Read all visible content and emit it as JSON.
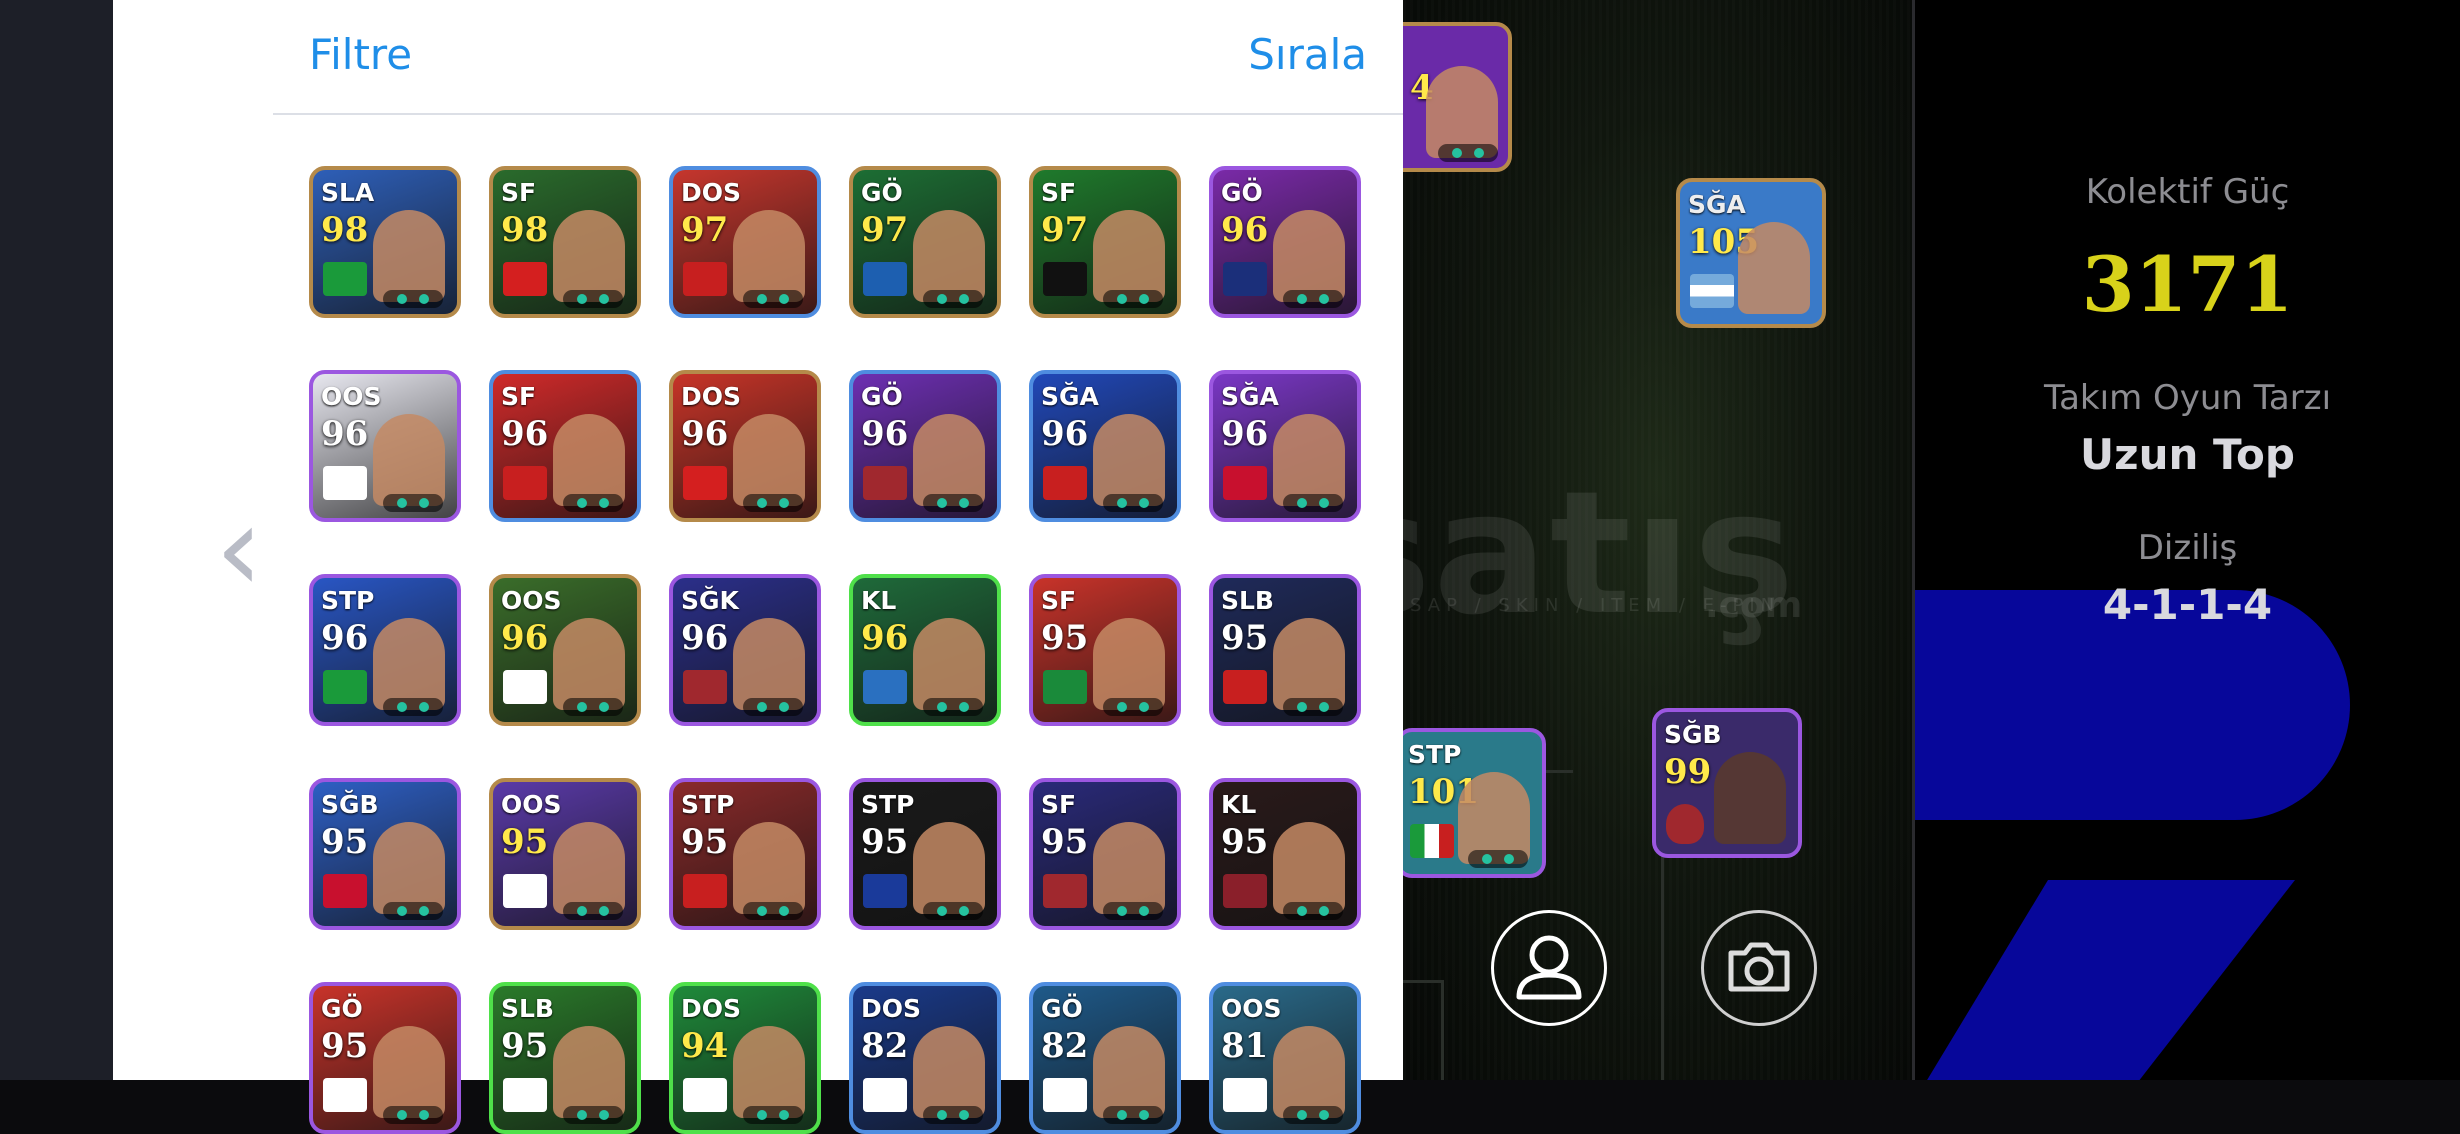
{
  "panel": {
    "filter_label": "Filtre",
    "sort_label": "Sırala"
  },
  "cards": [
    {
      "pos": "SLA",
      "rating": "98",
      "frame": "gold",
      "bg": "#2e5fb8",
      "badge": "#1a9a3a"
    },
    {
      "pos": "SF",
      "rating": "98",
      "frame": "gold",
      "bg": "#2a6b2c",
      "badge": "#d41f1f"
    },
    {
      "pos": "DOS",
      "rating": "97",
      "frame": "blue",
      "bg": "#c6362d",
      "badge": "#c71f1f"
    },
    {
      "pos": "GÖ",
      "rating": "97",
      "frame": "gold",
      "bg": "#1d6e34",
      "badge": "#1d5fb0"
    },
    {
      "pos": "SF",
      "rating": "97",
      "frame": "gold",
      "bg": "#1f7a2c",
      "badge": "#111111"
    },
    {
      "pos": "GÖ",
      "rating": "96",
      "frame": "purple",
      "bg": "#7a2aa8",
      "badge": "#1b2f7a"
    },
    {
      "pos": "OOS",
      "rating": "96",
      "frame": "purple",
      "bg": "#e7e7ef",
      "badge": "#ffffff",
      "white": true
    },
    {
      "pos": "SF",
      "rating": "96",
      "frame": "blue",
      "bg": "#d02a2a",
      "badge": "#c81f1f",
      "white": true
    },
    {
      "pos": "DOS",
      "rating": "96",
      "frame": "gold",
      "bg": "#c73428",
      "badge": "#d41f1f",
      "white": true
    },
    {
      "pos": "GÖ",
      "rating": "96",
      "frame": "blue",
      "bg": "#6d2fb2",
      "badge": "#a0282e",
      "white": true
    },
    {
      "pos": "SĞA",
      "rating": "96",
      "frame": "blue",
      "bg": "#2148b8",
      "badge": "#c81f1f",
      "white": true
    },
    {
      "pos": "SĞA",
      "rating": "96",
      "frame": "purple",
      "bg": "#7a37c5",
      "badge": "#c8102e",
      "white": true
    },
    {
      "pos": "STP",
      "rating": "96",
      "frame": "purple",
      "bg": "#2956c4",
      "badge": "#1a9a3a",
      "white": true
    },
    {
      "pos": "OOS",
      "rating": "96",
      "frame": "gold",
      "bg": "#3a6d2a",
      "badge": "#ffffff"
    },
    {
      "pos": "SĞK",
      "rating": "96",
      "frame": "purple",
      "bg": "#2b2f8a",
      "badge": "#a0282e",
      "white": true
    },
    {
      "pos": "KL",
      "rating": "96",
      "frame": "green",
      "bg": "#1f6a3a",
      "badge": "#2a70c0"
    },
    {
      "pos": "SF",
      "rating": "95",
      "frame": "purple",
      "bg": "#c8332a",
      "badge": "#1a8a3a",
      "white": true
    },
    {
      "pos": "SLB",
      "rating": "95",
      "frame": "purple",
      "bg": "#1f2a5a",
      "badge": "#c81f1f",
      "white": true
    },
    {
      "pos": "SĞB",
      "rating": "95",
      "frame": "purple",
      "bg": "#2e5fc4",
      "badge": "#c8102e",
      "white": true
    },
    {
      "pos": "OOS",
      "rating": "95",
      "frame": "gold",
      "bg": "#5a3aa8",
      "badge": "#ffffff"
    },
    {
      "pos": "STP",
      "rating": "95",
      "frame": "purple",
      "bg": "#8a2a2a",
      "badge": "#c81f1f",
      "white": true
    },
    {
      "pos": "STP",
      "rating": "95",
      "frame": "purple",
      "bg": "#1a1a1a",
      "badge": "#1a3a9a",
      "white": true
    },
    {
      "pos": "SF",
      "rating": "95",
      "frame": "purple",
      "bg": "#2a2a7a",
      "badge": "#a0282e",
      "white": true
    },
    {
      "pos": "KL",
      "rating": "95",
      "frame": "purple",
      "bg": "#2a1a1a",
      "badge": "#8a1f2a",
      "white": true
    },
    {
      "pos": "GÖ",
      "rating": "95",
      "frame": "purple",
      "bg": "#c8332a",
      "badge": "#ffffff",
      "white": true
    },
    {
      "pos": "SLB",
      "rating": "95",
      "frame": "green",
      "bg": "#2a7a2a",
      "badge": "#ffffff",
      "white": true
    },
    {
      "pos": "DOS",
      "rating": "94",
      "frame": "green",
      "bg": "#1f8a3a",
      "badge": "#ffffff"
    },
    {
      "pos": "DOS",
      "rating": "82",
      "frame": "blue",
      "bg": "#1a3a8a",
      "badge": "#ffffff",
      "white": true
    },
    {
      "pos": "GÖ",
      "rating": "82",
      "frame": "blue",
      "bg": "#1f5a8a",
      "badge": "#ffffff",
      "white": true
    },
    {
      "pos": "OOS",
      "rating": "81",
      "frame": "blue",
      "bg": "#2a6a8a",
      "badge": "#ffffff",
      "white": true
    }
  ],
  "field_cards": [
    {
      "pos": "SĞA",
      "rating": "105",
      "frame": "gold",
      "bg": "#3a7ac8"
    },
    {
      "pos": "STP",
      "rating": "101",
      "frame": "purple",
      "bg": "#2a7a8a"
    },
    {
      "pos": "SĞB",
      "rating": "99",
      "frame": "purple",
      "bg": "#3a2a6a"
    }
  ],
  "field_partial_card_rating": "4",
  "stats": {
    "team_strength_label": "Kolektif Güç",
    "team_strength_value": "3171",
    "team_strength_color": "#d8d21a",
    "playstyle_label": "Takım Oyun Tarzı",
    "playstyle_value": "Uzun Top",
    "formation_label": "Diziliş",
    "formation_value": "4-1-1-4"
  },
  "icons": {
    "profile": "user-icon",
    "camera": "camera-icon",
    "back": "chevron-left-icon"
  },
  "watermark": {
    "brand": "satış",
    "tagline": "SAP / SKIN / ITEM / E-PIN",
    "domain": ".com"
  }
}
